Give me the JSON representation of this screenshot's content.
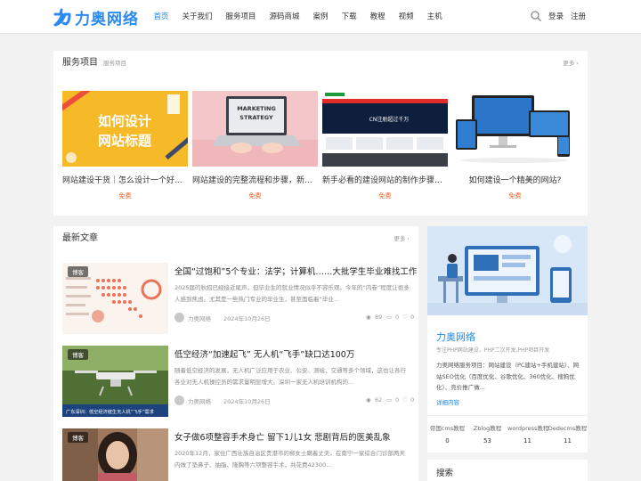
{
  "header": {
    "logo_text": "力奥网络",
    "nav": [
      "首页",
      "关于我们",
      "服务项目",
      "源码商城",
      "案例",
      "下载",
      "教程",
      "视频",
      "主机"
    ],
    "login": "登录",
    "register": "注册",
    "colors": {
      "accent": "#1e88e5",
      "price": "#f25c1f"
    }
  },
  "services": {
    "title": "服务项目",
    "subtitle": "服务项目",
    "more": "更多 ›",
    "items": [
      {
        "name": "网站建设干货｜怎么设计一个好...",
        "price": "免费",
        "thumb_text": [
          "如何设计",
          "网站标题"
        ]
      },
      {
        "name": "网站建设的完整流程和步骤，新...",
        "price": "免费",
        "thumb_text": [
          "MARKETING",
          "STRATEGY"
        ]
      },
      {
        "name": "新手必看的建设网站的制作步骤+...",
        "price": "免费",
        "thumb_text": [
          "CN注册超过千万"
        ]
      },
      {
        "name": "如何建设一个精美的网站?",
        "price": "免费"
      }
    ]
  },
  "news": {
    "title": "最新文章",
    "more": "更多 ›",
    "articles": [
      {
        "tag": "博客",
        "title": "全国“过饱和”5个专业：法学；计算机……大批学生毕业难找工作",
        "desc": "2025届的秋招已经接近尾声，但毕业生的就业情况似乎不容乐观。今年的“内卷”程度让很多人感到焦虑。尤其是一些热门专业的毕业生，甚至面临着“毕业...",
        "author": "力奥网络",
        "date": "2024年10月26日",
        "views": "89",
        "comments": "0",
        "likes": "0"
      },
      {
        "tag": "博客",
        "title": "低空经济“加速起飞” 无人机“飞手”缺口达100万",
        "desc": "随着低空经济的发展，无人机广泛应用于农业、公安、测绘、交通等多个领域，这也让各行各业对无人机操控员的需求量明显增大。深圳一家无人机培训机构的...",
        "author": "力奥网络",
        "date": "2024年10月26日",
        "views": "62",
        "comments": "0",
        "likes": "0",
        "thumb_caption": "广东深圳：低空经济催生无人机“飞手”需求"
      },
      {
        "tag": "博客",
        "title": "女子做6项整容手术身亡 留下1儿1女 悲剧背后的医美乱象",
        "desc": "2020年12月，家住广西壮族自治区贵港市的柳女士瞒着丈夫，在南宁一家综合门诊部两天内做了垫鼻子、抽脂、隆胸等六项整容手术，共花费42300..."
      }
    ]
  },
  "sidebar": {
    "name": "力奥网络",
    "subtitle": "专注PHP网站建设，PHP二次开发,PHP项目开发",
    "desc": "力奥网络服务项目：网站建设（PC建站+手机建站）、网站SEO优化（百度优化、谷歌优化、360优化、搜狗优化）、竞价推广做...",
    "link": "详细内容",
    "stats": [
      {
        "label": "帝国cms教程",
        "value": "0"
      },
      {
        "label": "Zblog教程",
        "value": "53"
      },
      {
        "label": "wordpress教程",
        "value": "11"
      },
      {
        "label": "Dedecms教程",
        "value": "11"
      }
    ],
    "search_title": "搜索"
  }
}
